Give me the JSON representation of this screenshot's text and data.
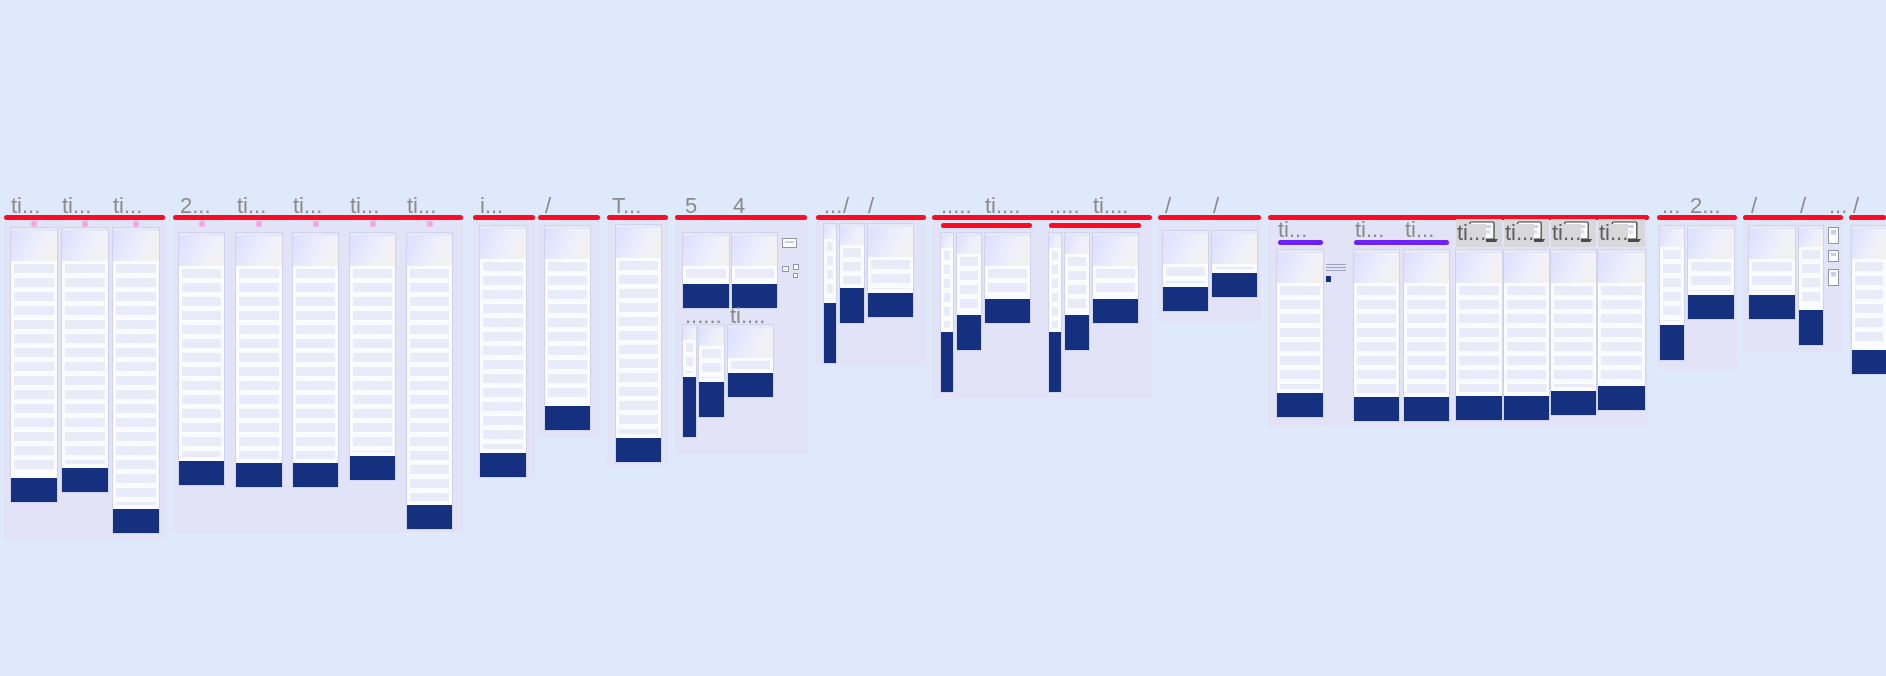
{
  "canvas": {
    "sections": [
      {
        "labels": [
          "ti...",
          "ti...",
          "ti..."
        ],
        "frames": [
          {
            "kind": "desktop",
            "marker": true
          },
          {
            "kind": "desktop",
            "marker": true
          },
          {
            "kind": "desktop",
            "marker": true
          }
        ]
      },
      {
        "labels": [
          "2...",
          "ti...",
          "ti...",
          "ti...",
          "ti..."
        ],
        "frames": [
          {
            "kind": "desktop",
            "marker": true
          },
          {
            "kind": "desktop",
            "marker": true
          },
          {
            "kind": "desktop",
            "marker": true
          },
          {
            "kind": "desktop",
            "marker": true
          },
          {
            "kind": "desktop",
            "marker": true
          }
        ]
      },
      {
        "labels": [
          "i..."
        ],
        "frames": [
          {
            "kind": "desktop",
            "marker": false
          }
        ]
      },
      {
        "labels": [
          "/"
        ],
        "frames": [
          {
            "kind": "desktop",
            "marker": false
          }
        ]
      },
      {
        "labels": [
          "T..."
        ],
        "frames": [
          {
            "kind": "desktop",
            "marker": false
          }
        ]
      },
      {
        "labels": [
          "5",
          "4",
          "......",
          "ti...."
        ],
        "frames": [
          {
            "kind": "desktop",
            "marker": false
          },
          {
            "kind": "desktop",
            "marker": false
          },
          {
            "kind": "card",
            "marker": false
          },
          {
            "kind": "card",
            "marker": false
          },
          {
            "kind": "card",
            "marker": false
          },
          {
            "kind": "card",
            "marker": false
          },
          {
            "kind": "mobile",
            "marker": false
          },
          {
            "kind": "tablet",
            "marker": false
          },
          {
            "kind": "desktop",
            "marker": false
          }
        ]
      },
      {
        "labels": [
          "...",
          "/",
          "/"
        ],
        "frames": [
          {
            "kind": "mobile",
            "marker": false
          },
          {
            "kind": "tablet",
            "marker": false
          },
          {
            "kind": "desktop",
            "marker": false
          }
        ]
      },
      {
        "groups": [
          {
            "color": "#ff0a23"
          },
          {
            "color": "#ff0a23"
          }
        ],
        "labels": [
          ".....",
          "ti....",
          ".....",
          "ti...."
        ],
        "frames": [
          {
            "kind": "mobile",
            "marker": false
          },
          {
            "kind": "tablet",
            "marker": false
          },
          {
            "kind": "desktop",
            "marker": false
          },
          {
            "kind": "mobile",
            "marker": false
          },
          {
            "kind": "tablet",
            "marker": false
          },
          {
            "kind": "desktop",
            "marker": false
          }
        ]
      },
      {
        "labels": [
          "/",
          "/"
        ],
        "frames": [
          {
            "kind": "desktop",
            "marker": false
          },
          {
            "kind": "desktop",
            "marker": false
          }
        ]
      },
      {
        "groups": [
          {
            "color": "#6b22ff"
          },
          {
            "color": "#6b22ff"
          }
        ],
        "labels": [
          "ti...",
          "ti...",
          "ti...",
          "ti...",
          "ti...",
          "ti...",
          "ti..."
        ],
        "frames": [
          {
            "kind": "desktop",
            "marker": false
          },
          {
            "kind": "note",
            "marker": false
          },
          {
            "kind": "desktop",
            "marker": false
          },
          {
            "kind": "desktop",
            "marker": false
          },
          {
            "kind": "device",
            "marker": false
          },
          {
            "kind": "desktop",
            "marker": false
          },
          {
            "kind": "device",
            "marker": false
          },
          {
            "kind": "desktop",
            "marker": false
          },
          {
            "kind": "device",
            "marker": false
          },
          {
            "kind": "desktop",
            "marker": false
          },
          {
            "kind": "device",
            "marker": false
          },
          {
            "kind": "desktop",
            "marker": false
          }
        ]
      },
      {
        "labels": [
          "...",
          "2..."
        ],
        "frames": [
          {
            "kind": "tablet",
            "marker": false
          },
          {
            "kind": "desktop",
            "marker": false
          }
        ]
      },
      {
        "labels": [
          "/",
          "/",
          "..."
        ],
        "frames": [
          {
            "kind": "desktop",
            "marker": false
          },
          {
            "kind": "tablet",
            "marker": false
          },
          {
            "kind": "card",
            "marker": false
          },
          {
            "kind": "card",
            "marker": false
          },
          {
            "kind": "card",
            "marker": false
          }
        ]
      },
      {
        "labels": [
          "/"
        ],
        "frames": [
          {
            "kind": "desktop",
            "marker": false
          }
        ]
      }
    ]
  }
}
